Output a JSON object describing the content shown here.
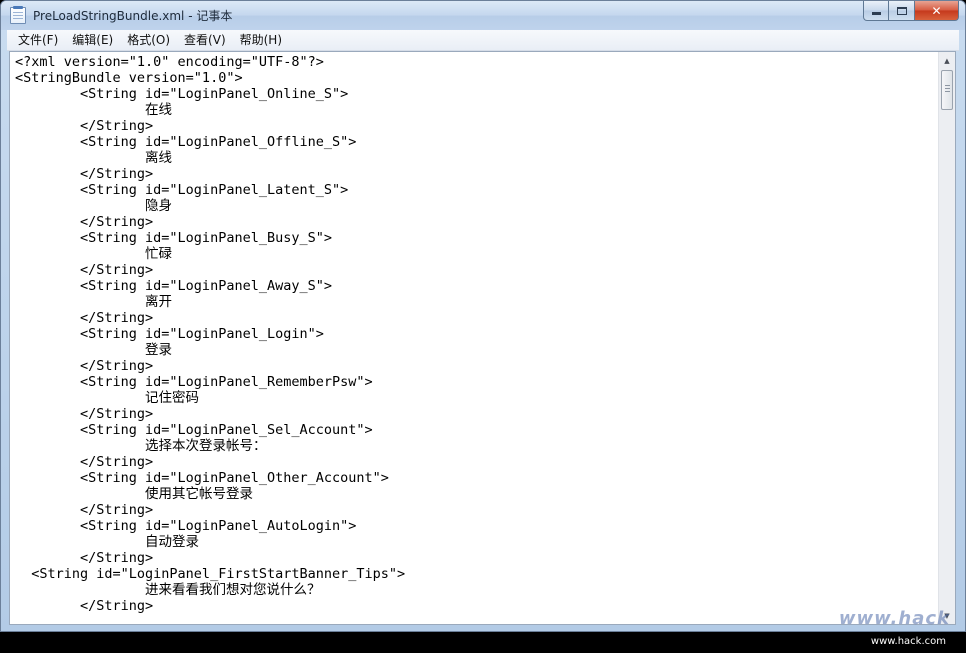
{
  "window": {
    "title": "PreLoadStringBundle.xml - 记事本",
    "close_glyph": "✕"
  },
  "menu": [
    {
      "label": "文件(F)"
    },
    {
      "label": "编辑(E)"
    },
    {
      "label": "格式(O)"
    },
    {
      "label": "查看(V)"
    },
    {
      "label": "帮助(H)"
    }
  ],
  "document": {
    "lines": [
      "<?xml version=\"1.0\" encoding=\"UTF-8\"?>",
      "<StringBundle version=\"1.0\">",
      "        <String id=\"LoginPanel_Online_S\">",
      "                在线",
      "        </String>",
      "        <String id=\"LoginPanel_Offline_S\">",
      "                离线",
      "        </String>",
      "        <String id=\"LoginPanel_Latent_S\">",
      "                隐身",
      "        </String>",
      "        <String id=\"LoginPanel_Busy_S\">",
      "                忙碌",
      "        </String>",
      "        <String id=\"LoginPanel_Away_S\">",
      "                离开",
      "        </String>",
      "        <String id=\"LoginPanel_Login\">",
      "                登录",
      "        </String>",
      "        <String id=\"LoginPanel_RememberPsw\">",
      "                记住密码",
      "        </String>",
      "        <String id=\"LoginPanel_Sel_Account\">",
      "                选择本次登录帐号：",
      "        </String>",
      "        <String id=\"LoginPanel_Other_Account\">",
      "                使用其它帐号登录",
      "        </String>",
      "        <String id=\"LoginPanel_AutoLogin\">",
      "                自动登录",
      "        </String>",
      "  <String id=\"LoginPanel_FirstStartBanner_Tips\">",
      "                进来看看我们想对您说什么？",
      "        </String>"
    ]
  },
  "watermark": {
    "text": "www.hack",
    "sub": "www.hack.com"
  }
}
